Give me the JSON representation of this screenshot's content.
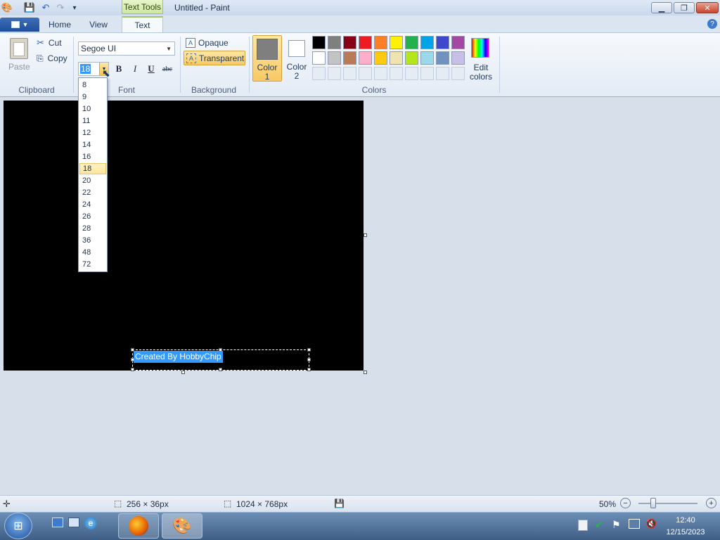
{
  "window": {
    "title": "Untitled - Paint",
    "context_tab": "Text Tools"
  },
  "tabs": {
    "file": "",
    "home": "Home",
    "view": "View",
    "text": "Text"
  },
  "clipboard": {
    "paste": "Paste",
    "cut": "Cut",
    "copy": "Copy",
    "group": "Clipboard"
  },
  "font": {
    "family": "Segoe UI",
    "size": "18",
    "group": "Font",
    "sizes": [
      "8",
      "9",
      "10",
      "11",
      "12",
      "14",
      "16",
      "18",
      "20",
      "22",
      "24",
      "26",
      "28",
      "36",
      "48",
      "72"
    ],
    "bold": "B",
    "italic": "I",
    "underline": "U",
    "strike": "abc"
  },
  "background": {
    "opaque": "Opaque",
    "transparent": "Transparent",
    "group": "Background"
  },
  "colors": {
    "color1_line1": "Color",
    "color1_line2": "1",
    "color2_line1": "Color",
    "color2_line2": "2",
    "edit_line1": "Edit",
    "edit_line2": "colors",
    "group": "Colors",
    "color1": "#7f7f7f",
    "color2": "#ffffff",
    "palette_row1": [
      "#000000",
      "#7f7f7f",
      "#880015",
      "#ed1c24",
      "#ff7f27",
      "#fff200",
      "#22b14c",
      "#00a2e8",
      "#3f48cc",
      "#a349a4"
    ],
    "palette_row2": [
      "#ffffff",
      "#c3c3c3",
      "#b97a57",
      "#ffaec9",
      "#ffc90e",
      "#efe4b0",
      "#b5e61d",
      "#99d9ea",
      "#7092be",
      "#c8bfe7"
    ]
  },
  "canvas": {
    "text": "Created By HobbyChip"
  },
  "status": {
    "selection": "256 × 36px",
    "image_size": "1024 × 768px",
    "zoom": "50%"
  },
  "taskbar": {
    "time": "12:40",
    "date": "12/15/2023"
  }
}
